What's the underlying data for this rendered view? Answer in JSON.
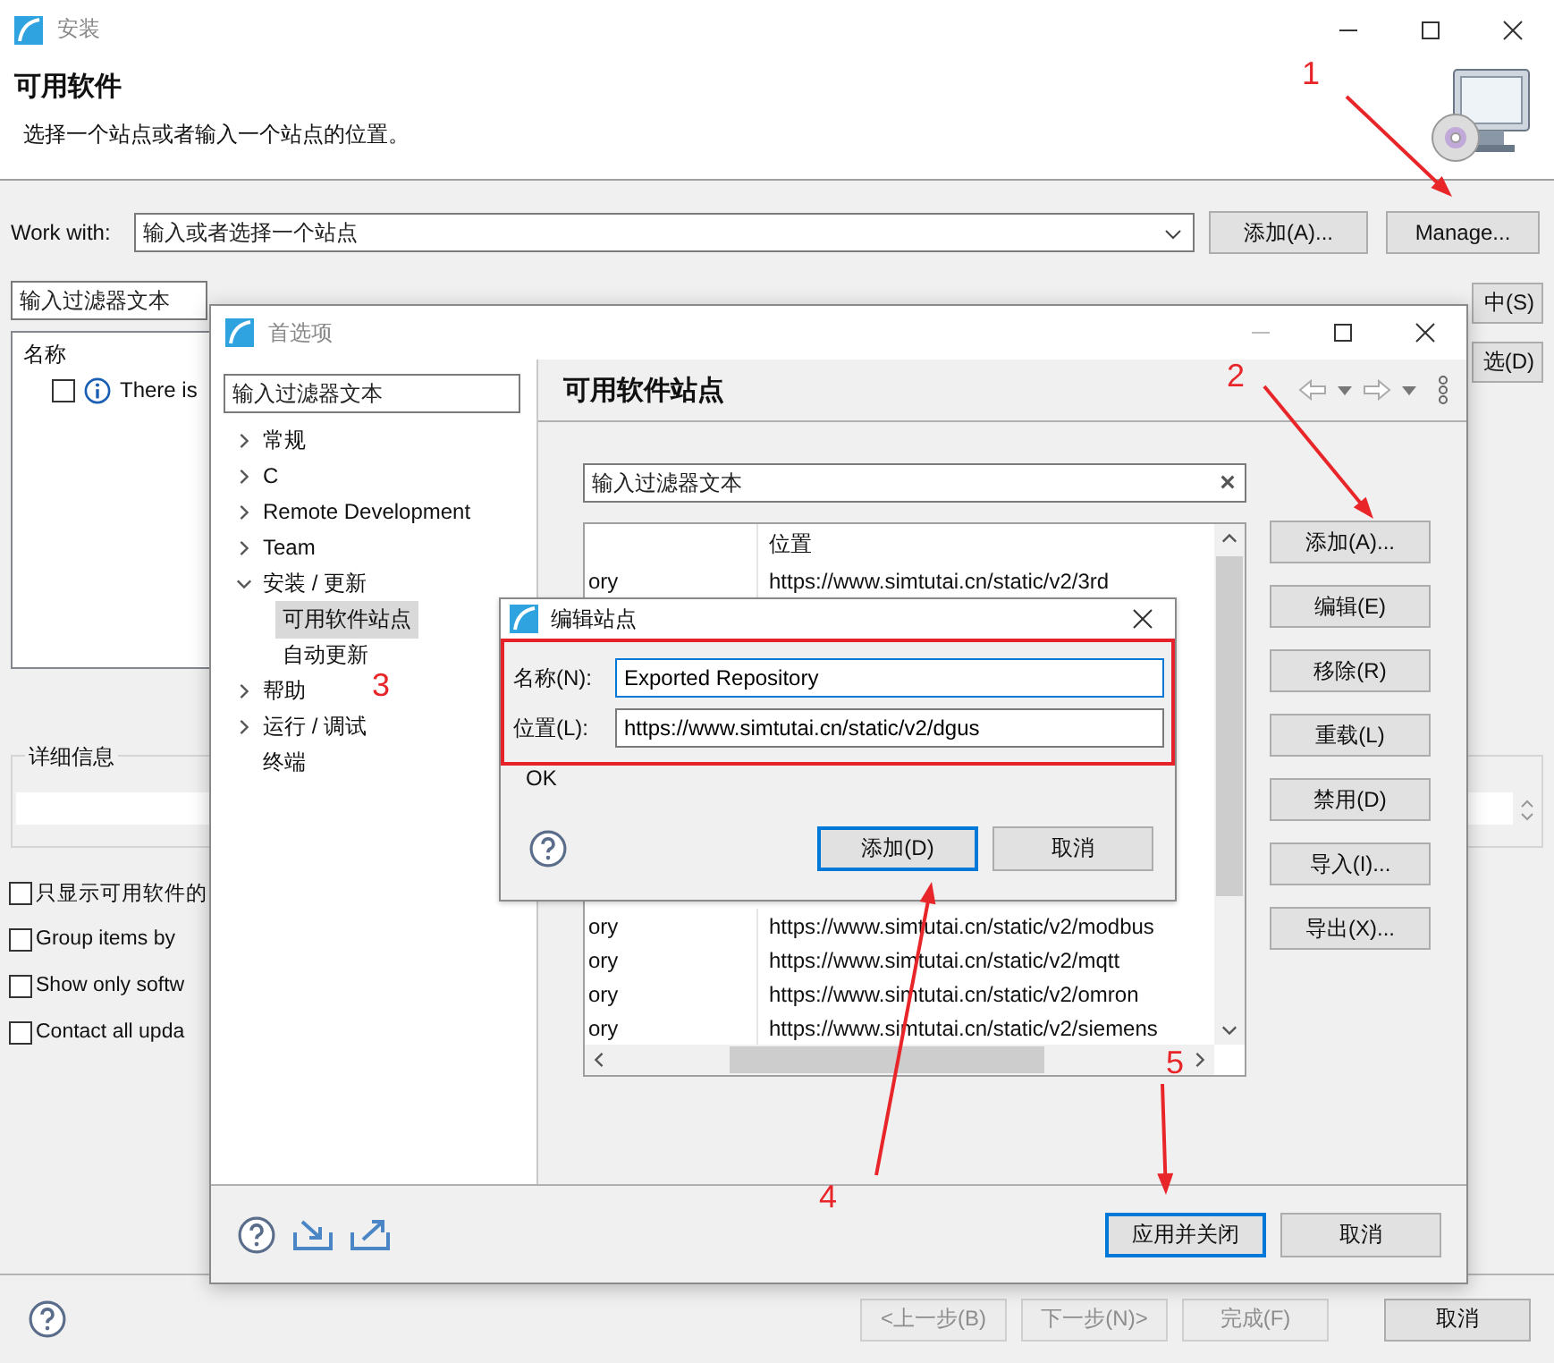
{
  "install_window": {
    "title": "安装",
    "heading": "可用软件",
    "description": "选择一个站点或者输入一个站点的位置。",
    "work_with": {
      "label": "Work with:",
      "placeholder": "输入或者选择一个站点"
    },
    "work_buttons": [
      "添加(A)...",
      "Manage..."
    ],
    "filter": {
      "placeholder": "输入过滤器文本"
    },
    "side_buttons": [
      "中(S)",
      "选(D)"
    ],
    "tree": {
      "column": "名称",
      "items": [
        {
          "label": "There is",
          "checked": false
        }
      ]
    },
    "details": {
      "legend": "详细信息"
    },
    "options": [
      {
        "label": "只显示可用软件的",
        "checked": false
      },
      {
        "label": "Group items by",
        "checked": false
      },
      {
        "label": "Show only softw",
        "checked": false
      },
      {
        "label": "Contact all upda",
        "checked": false
      }
    ],
    "wizard_buttons": [
      {
        "label": "<上一步(B)",
        "disabled": true
      },
      {
        "label": "下一步(N)>",
        "disabled": true
      },
      {
        "label": "完成(F)",
        "disabled": true
      },
      {
        "label": "取消",
        "disabled": false
      }
    ]
  },
  "preferences": {
    "title": "首选项",
    "filter": {
      "placeholder": "输入过滤器文本"
    },
    "tree": [
      {
        "label": "常规",
        "kind": "folder",
        "expanded": false,
        "selected": false
      },
      {
        "label": "C",
        "kind": "folder",
        "expanded": false,
        "selected": false
      },
      {
        "label": "Remote Development",
        "kind": "folder",
        "expanded": false,
        "selected": false
      },
      {
        "label": "Team",
        "kind": "folder",
        "expanded": false,
        "selected": false
      },
      {
        "label": "安装 / 更新",
        "kind": "folder",
        "expanded": true,
        "selected": false,
        "children": [
          {
            "label": "可用软件站点",
            "selected": true
          },
          {
            "label": "自动更新",
            "selected": false
          }
        ]
      },
      {
        "label": "帮助",
        "kind": "folder",
        "expanded": false,
        "selected": false
      },
      {
        "label": "运行 / 调试",
        "kind": "folder",
        "expanded": false,
        "selected": false
      },
      {
        "label": "终端",
        "kind": "leaf",
        "selected": false
      }
    ],
    "page_title": "可用软件站点",
    "site_filter": {
      "placeholder": "输入过滤器文本"
    },
    "table": {
      "location_heading": "位置",
      "rows": [
        {
          "name": "ory",
          "location": "https://www.simtutai.cn/static/v2/3rd"
        },
        {
          "name": "ory",
          "location": "https://www.simtutai.cn/static/v2/modbus"
        },
        {
          "name": "ory",
          "location": "https://www.simtutai.cn/static/v2/mqtt"
        },
        {
          "name": "ory",
          "location": "https://www.simtutai.cn/static/v2/omron"
        },
        {
          "name": "ory",
          "location": "https://www.simtutai.cn/static/v2/siemens"
        }
      ]
    },
    "buttons": [
      "添加(A)...",
      "编辑(E)",
      "移除(R)",
      "重载(L)",
      "禁用(D)",
      "导入(I)...",
      "导出(X)..."
    ],
    "footer_buttons": [
      {
        "label": "应用并关闭",
        "default": true
      },
      {
        "label": "取消",
        "default": false
      }
    ]
  },
  "edit_dialog": {
    "title": "编辑站点",
    "fields": [
      {
        "label": "名称(N):",
        "value": "Exported Repository",
        "focused": true
      },
      {
        "label": "位置(L):",
        "value": "https://www.simtutai.cn/static/v2/dgus",
        "focused": false
      }
    ],
    "message": "OK",
    "buttons": [
      {
        "label": "添加(D)",
        "default": true
      },
      {
        "label": "取消",
        "default": false
      }
    ]
  },
  "annotations": [
    {
      "label": "1",
      "arrow": true
    },
    {
      "label": "2",
      "arrow": true
    },
    {
      "label": "3",
      "arrow": false
    },
    {
      "label": "4",
      "arrow": true
    },
    {
      "label": "5",
      "arrow": true
    }
  ]
}
